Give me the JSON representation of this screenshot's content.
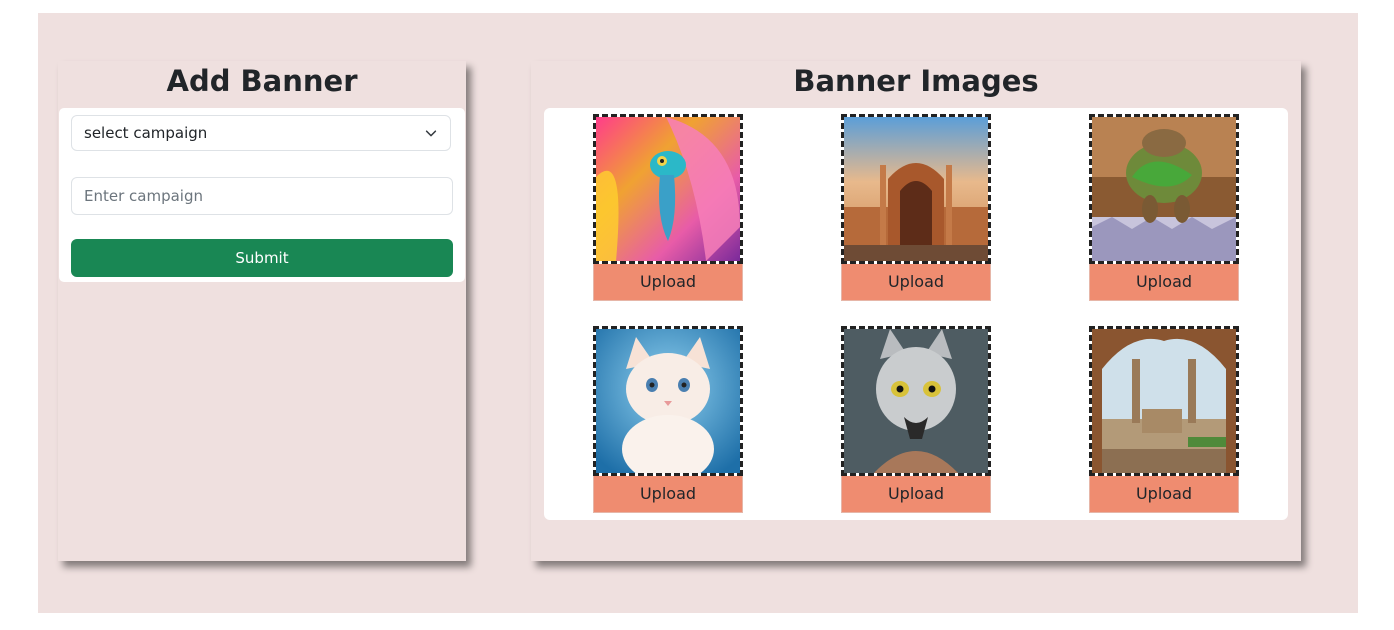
{
  "add_banner": {
    "title": "Add Banner",
    "select_value": "select campaign",
    "campaign_placeholder": "Enter campaign",
    "submit_label": "Submit"
  },
  "banner_images": {
    "title": "Banner Images",
    "tiles": [
      {
        "subject": "chameleon-on-flower-image",
        "upload_label": "Upload"
      },
      {
        "subject": "historic-gate-building-image",
        "upload_label": "Upload"
      },
      {
        "subject": "tortoise-with-lettuce-image",
        "upload_label": "Upload"
      },
      {
        "subject": "white-kitten-image",
        "upload_label": "Upload"
      },
      {
        "subject": "masked-cat-warrior-image",
        "upload_label": "Upload"
      },
      {
        "subject": "minaret-view-through-arch-image",
        "upload_label": "Upload"
      }
    ]
  },
  "colors": {
    "page_background": "#efe0df",
    "submit_button": "#198754",
    "upload_button": "#ef8c70"
  }
}
